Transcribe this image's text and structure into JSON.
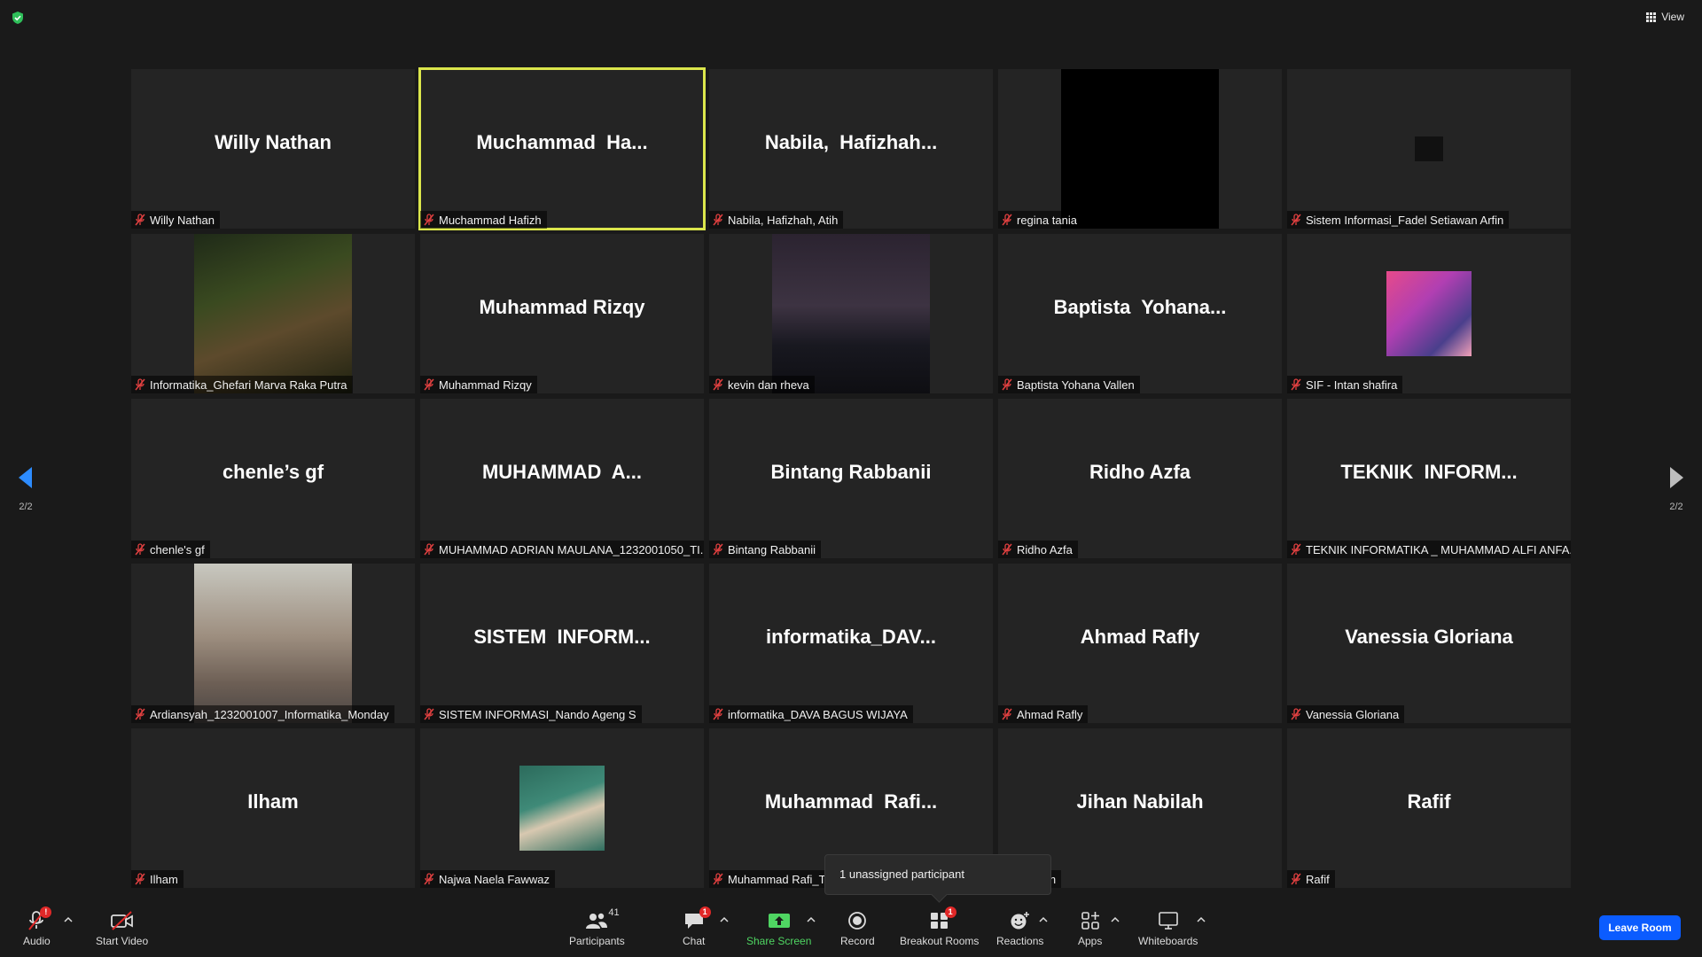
{
  "header": {
    "view_label": "View"
  },
  "navigation": {
    "page_left": "2/2",
    "page_right": "2/2"
  },
  "tiles": [
    {
      "display": "Willy Nathan",
      "tag": "Willy Nathan"
    },
    {
      "display": "Muchammad  Ha...",
      "tag": "Muchammad Hafizh",
      "active": true
    },
    {
      "display": "Nabila,  Hafizhah...",
      "tag": "Nabila, Hafizhah, Atih"
    },
    {
      "display": "",
      "tag": "regina tania",
      "video": "black"
    },
    {
      "display": "",
      "tag": "Sistem Informasi_Fadel Setiawan Arfin",
      "video": "small"
    },
    {
      "display": "",
      "tag": "Informatika_Ghefari Marva Raka Putra",
      "video": "photo1"
    },
    {
      "display": "Muhammad Rizqy",
      "tag": "Muhammad Rizqy"
    },
    {
      "display": "",
      "tag": "kevin dan rheva",
      "video": "photo2"
    },
    {
      "display": "Baptista  Yohana...",
      "tag": "Baptista Yohana Vallen"
    },
    {
      "display": "",
      "tag": "SIF - Intan shafira",
      "video": "anime"
    },
    {
      "display": "chenle’s gf",
      "tag": "chenle's gf"
    },
    {
      "display": "MUHAMMAD  A...",
      "tag": "MUHAMMAD ADRIAN MAULANA_1232001050_TI..."
    },
    {
      "display": "Bintang Rabbanii",
      "tag": "Bintang Rabbanii"
    },
    {
      "display": "Ridho Azfa",
      "tag": "Ridho Azfa"
    },
    {
      "display": "TEKNIK  INFORM...",
      "tag": "TEKNIK INFORMATIKA _ MUHAMMAD ALFI ANFA..."
    },
    {
      "display": "",
      "tag": "Ardiansyah_1232001007_Informatika_Monday",
      "video": "photo3"
    },
    {
      "display": "SISTEM  INFORM...",
      "tag": "SISTEM INFORMASI_Nando Ageng S"
    },
    {
      "display": "informatika_DAV...",
      "tag": "informatika_DAVA BAGUS WIJAYA"
    },
    {
      "display": "Ahmad Rafly",
      "tag": "Ahmad Rafly"
    },
    {
      "display": "Vanessia Gloriana",
      "tag": "Vanessia Gloriana"
    },
    {
      "display": "Ilham",
      "tag": "Ilham"
    },
    {
      "display": "",
      "tag": "Najwa Naela Fawwaz",
      "video": "cat"
    },
    {
      "display": "Muhammad  Rafi...",
      "tag": "Muhammad Rafi_T"
    },
    {
      "display": "Jihan Nabilah",
      "tag": "Nabilah"
    },
    {
      "display": "Rafif",
      "tag": "Rafif"
    }
  ],
  "tooltip": {
    "text": "1 unassigned participant"
  },
  "toolbar": {
    "audio": {
      "label": "Audio",
      "badge": "!"
    },
    "start_video": {
      "label": "Start Video"
    },
    "participants": {
      "label": "Participants",
      "count": "41"
    },
    "chat": {
      "label": "Chat",
      "badge": "1"
    },
    "share_screen": {
      "label": "Share Screen"
    },
    "record": {
      "label": "Record"
    },
    "breakout_rooms": {
      "label": "Breakout Rooms",
      "badge": "1"
    },
    "reactions": {
      "label": "Reactions"
    },
    "apps": {
      "label": "Apps"
    },
    "whiteboards": {
      "label": "Whiteboards"
    },
    "leave_room": {
      "label": "Leave Room"
    }
  },
  "colors": {
    "active_border": "#dbe64c",
    "share_green": "#4fd562",
    "leave_blue": "#0b5cff",
    "badge_red": "#e02828"
  }
}
